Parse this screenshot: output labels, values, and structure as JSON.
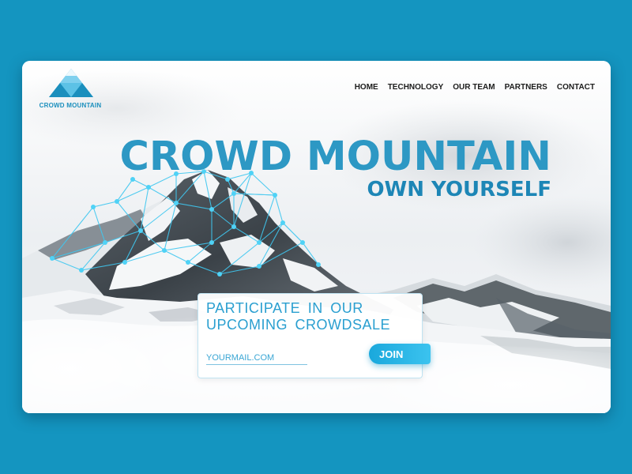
{
  "brand": {
    "logo_text": "CROWD MOUNTAIN",
    "color": "#1b8fbd"
  },
  "nav": {
    "items": [
      {
        "label": "HOME"
      },
      {
        "label": "TECHNOLOGY"
      },
      {
        "label": "OUR TEAM"
      },
      {
        "label": "PARTNERS"
      },
      {
        "label": "CONTACT"
      }
    ]
  },
  "hero": {
    "title": "CROWD MOUNTAIN",
    "subtitle": "OWN YOURSELF"
  },
  "signup": {
    "heading": "PARTICIPATE IN OUR UPCOMING CROWDSALE",
    "email_placeholder": "YOURMAIL.COM",
    "join_label": "JOIN"
  },
  "colors": {
    "background": "#1495c0",
    "accent": "#2a9fd0",
    "button": "#1aa8dc",
    "network": "#3fc7f0"
  },
  "icons": {
    "logo": "triangle-mountain-icon",
    "mountain": "snowy-mountain-image",
    "network": "connection-network-overlay"
  }
}
